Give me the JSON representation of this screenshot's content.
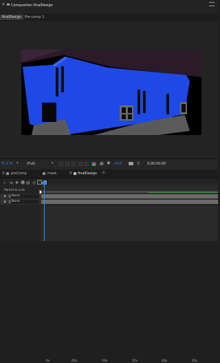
{
  "composition_panel": {
    "title": "Composition finalDesign",
    "tabs": [
      {
        "label": "finalDesign",
        "active": true
      },
      {
        "label": "Pre-comp 1",
        "active": false
      }
    ]
  },
  "viewer_toolbar": {
    "zoom": "72.2 %",
    "resolution": "(Full)",
    "exposure": "+0.0",
    "timecode": "0;00;00;00"
  },
  "timeline": {
    "tabs": [
      {
        "label": "preComp",
        "active": false
      },
      {
        "label": "mask",
        "active": false
      },
      {
        "label": "finalDesign",
        "active": true
      }
    ],
    "ruler_ticks": [
      "0s",
      "05s",
      "10s",
      "15s",
      "20s",
      "25s"
    ],
    "parent_link_label": "Parent & Link",
    "layers": [
      {
        "parent": "None"
      },
      {
        "parent": "None"
      }
    ],
    "tooltip": "Graph Editor"
  },
  "colors": {
    "building": "#1e49e6",
    "sky": "#2b1a28",
    "ground": "#5a5a5a",
    "accent_blue": "#2d8ceb",
    "work_area_green": "#3f9d3f"
  }
}
